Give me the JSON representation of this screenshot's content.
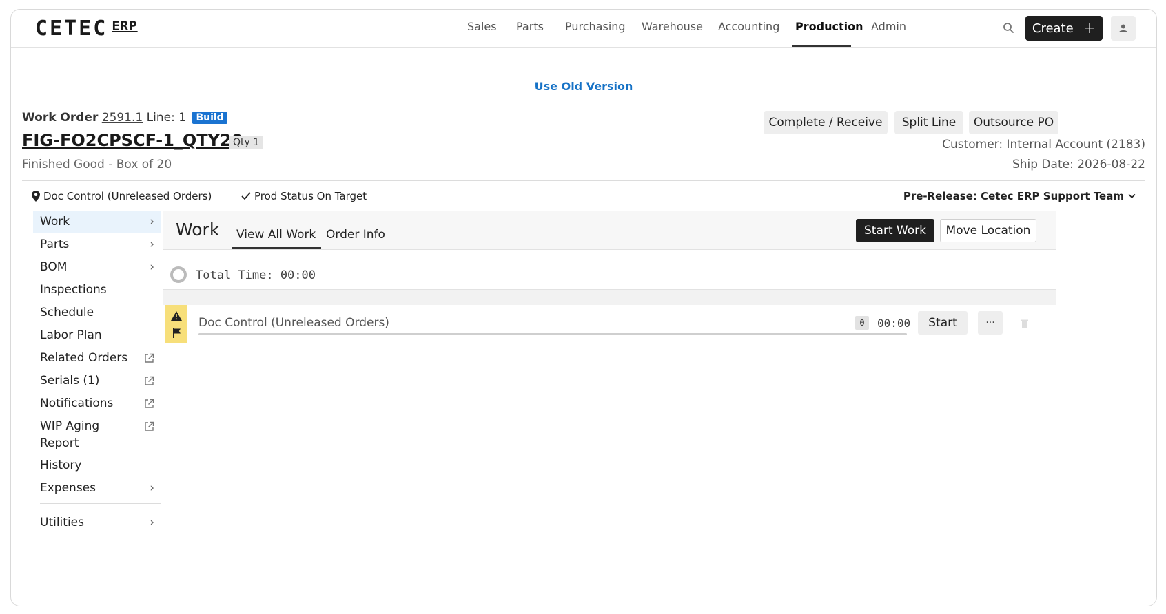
{
  "app": {
    "logo_main": "CETEC",
    "logo_sub": "ERP"
  },
  "nav": {
    "items": [
      "Sales",
      "Parts",
      "Purchasing",
      "Warehouse",
      "Accounting",
      "Production",
      "Admin"
    ],
    "active": "Production",
    "create_label": "Create"
  },
  "banner": {
    "old_version_link": "Use Old Version"
  },
  "work_order": {
    "label": "Work Order",
    "number": "2591.1",
    "line_text": "Line: 1",
    "badge": "Build",
    "part": "FIG-FO2CPSCF-1_QTY20",
    "qty_badge": "Qty 1",
    "description": "Finished Good - Box of 20",
    "customer": "Customer: Internal Account (2183)",
    "ship_date": "Ship Date: 2026-08-22"
  },
  "actions": {
    "complete_receive": "Complete / Receive",
    "split_line": "Split Line",
    "outsource_po": "Outsource PO"
  },
  "status": {
    "location": "Doc Control (Unreleased Orders)",
    "prod_status": "Prod Status On Target",
    "prerelease": "Pre-Release: Cetec ERP Support Team"
  },
  "sidebar": {
    "items": [
      {
        "label": "Work",
        "icon": "chevron-right-icon"
      },
      {
        "label": "Parts",
        "icon": "chevron-right-icon"
      },
      {
        "label": "BOM",
        "icon": "chevron-right-icon"
      },
      {
        "label": "Inspections",
        "icon": ""
      },
      {
        "label": "Schedule",
        "icon": ""
      },
      {
        "label": "Labor Plan",
        "icon": ""
      },
      {
        "label": "Related Orders",
        "icon": "external-link-icon"
      },
      {
        "label": "Serials (1)",
        "icon": "external-link-icon"
      },
      {
        "label": "Notifications",
        "icon": "external-link-icon"
      },
      {
        "label": "WIP Aging Report",
        "icon": "external-link-icon"
      },
      {
        "label": "History",
        "icon": ""
      },
      {
        "label": "Expenses",
        "icon": "chevron-right-icon"
      },
      {
        "label": "Utilities",
        "icon": "chevron-right-icon"
      }
    ],
    "active": "Work",
    "wip_line1": "WIP Aging",
    "wip_line2": "Report"
  },
  "main": {
    "title": "Work",
    "tabs": [
      "View All Work",
      "Order Info"
    ],
    "active_tab": "View All Work",
    "start_work": "Start Work",
    "move_location": "Move Location",
    "total_time": "Total Time: 00:00"
  },
  "task": {
    "name": "Doc Control (Unreleased Orders)",
    "count": "0",
    "time": "00:00",
    "start": "Start",
    "more": "···",
    "flag_color": "#f7df7a"
  }
}
